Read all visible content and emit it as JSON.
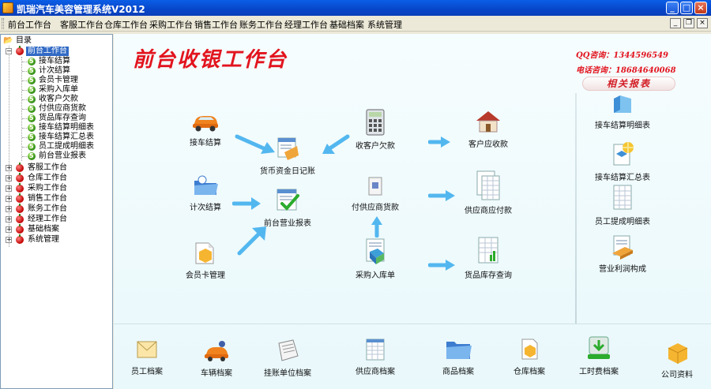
{
  "window": {
    "title": "凯瑞汽车美容管理系统V2012"
  },
  "menu": [
    "前台工作台",
    "客服工作台",
    "仓库工作台",
    "采购工作台",
    "销售工作台",
    "账务工作台",
    "经理工作台",
    "基础档案",
    "系统管理"
  ],
  "tree": {
    "root": "目录",
    "expanded": "前台工作台",
    "children": [
      "接车结算",
      "计次结算",
      "会员卡管理",
      "采购入库单",
      "收客户欠款",
      "付供应商货款",
      "货品库存查询",
      "接车结算明细表",
      "接车结算汇总表",
      "员工提成明细表",
      "前台营业报表"
    ],
    "collapsed": [
      "客服工作台",
      "仓库工作台",
      "采购工作台",
      "销售工作台",
      "账务工作台",
      "经理工作台",
      "基础档案",
      "系统管理"
    ]
  },
  "main": {
    "title": "前台收银工作台",
    "qq": "QQ咨询：1344596549",
    "phone": "电话咨询：18684640068",
    "reports_header": "相关报表",
    "modules": {
      "checkout": "接车结算",
      "count_checkout": "计次结算",
      "member_card": "会员卡管理",
      "cash_journal": "货币资金日记账",
      "daily_report": "前台营业报表",
      "collect_arrears": "收客户欠款",
      "pay_supplier": "付供应商货款",
      "purchase_in": "采购入库单",
      "receivables": "客户应收款",
      "payables": "供应商应付款",
      "stock_query": "货品库存查询"
    },
    "reports": [
      "接车结算明细表",
      "接车结算汇总表",
      "员工提成明细表",
      "营业利润构成"
    ],
    "archives": [
      "员工档案",
      "车辆档案",
      "挂账单位档案",
      "供应商档案",
      "商品档案",
      "仓库档案",
      "工时费档案",
      "公司资料"
    ]
  },
  "colors": {
    "accent_red": "#e2141e",
    "titlebar_blue": "#0a5ee6",
    "arrow_blue": "#53b7ef",
    "bg": "#f6fdfe"
  }
}
